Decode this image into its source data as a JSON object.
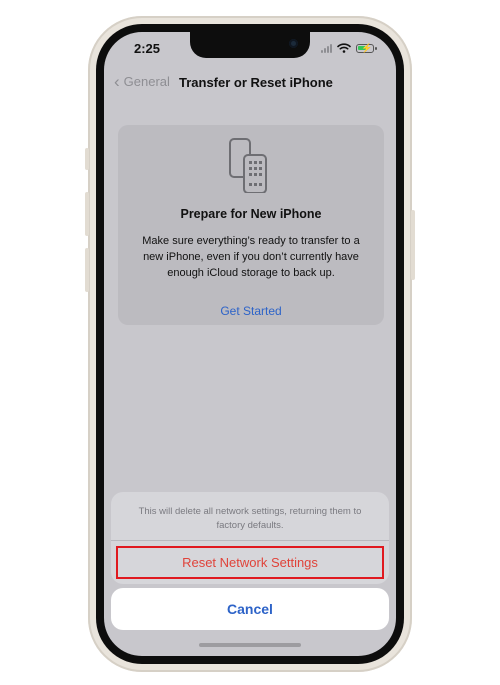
{
  "status_bar": {
    "time": "2:25"
  },
  "nav": {
    "back_label": "General",
    "title": "Transfer or Reset iPhone"
  },
  "card": {
    "icon": "devices-icon",
    "title": "Prepare for New iPhone",
    "body": "Make sure everything’s ready to transfer to a new iPhone, even if you don’t currently have enough iCloud storage to back up.",
    "link": "Get Started"
  },
  "action_sheet": {
    "message": "This will delete all network settings, returning them to factory defaults.",
    "reset_label": "Reset Network Settings",
    "cancel_label": "Cancel"
  },
  "colors": {
    "accent_blue": "#2d63c8",
    "destructive_red": "#e0433a",
    "highlight_box": "#e0191f"
  }
}
